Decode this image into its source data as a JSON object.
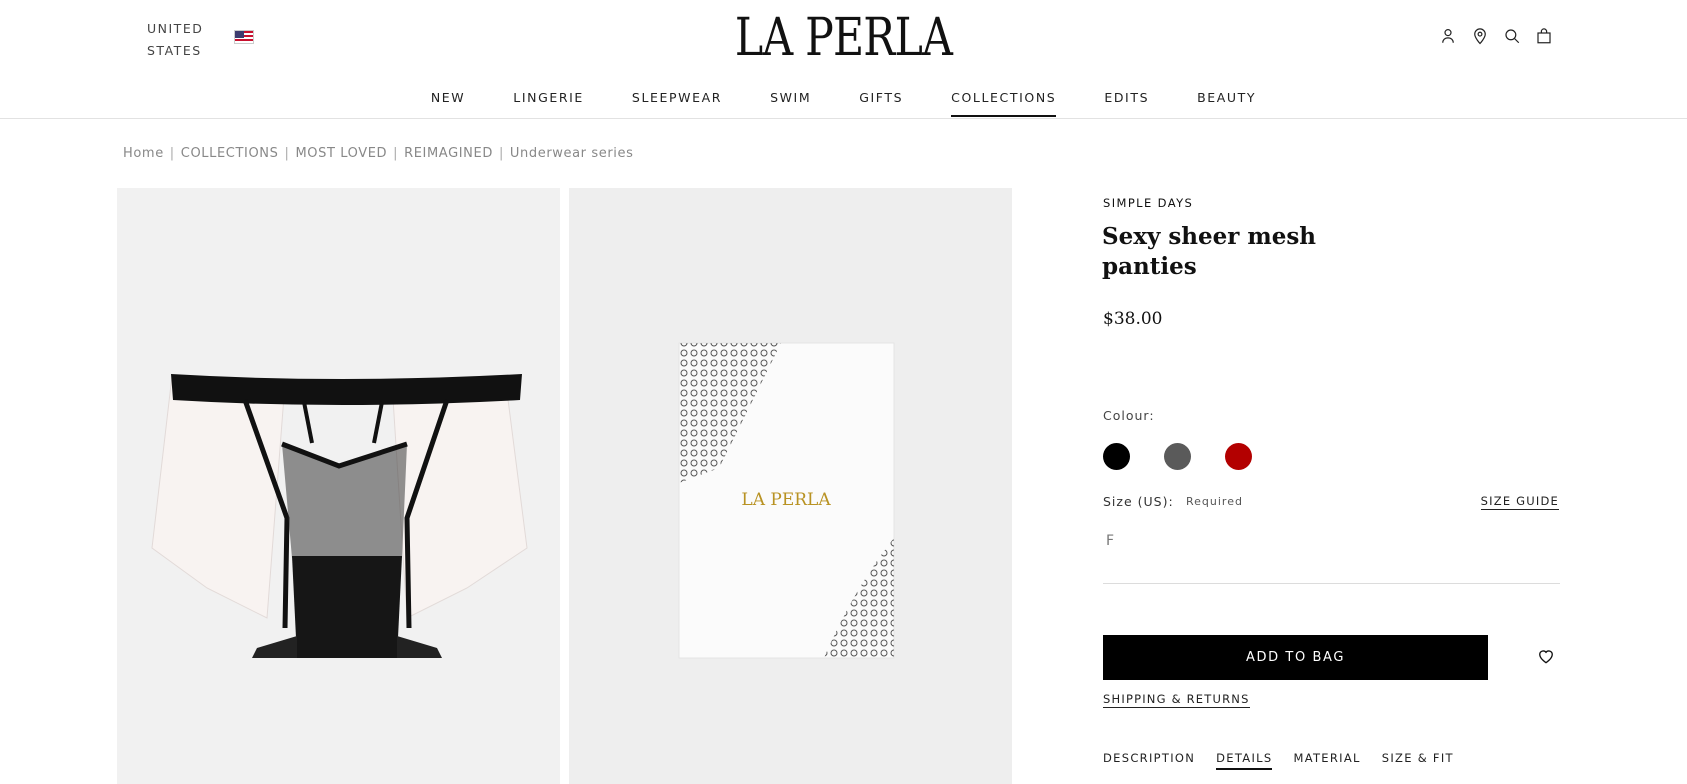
{
  "header": {
    "region_line1": "UNITED",
    "region_line2": "STATES",
    "logo": "LA PERLA",
    "icons": [
      "account-icon",
      "store-locator-icon",
      "search-icon",
      "bag-icon"
    ]
  },
  "nav": [
    "NEW",
    "LINGERIE",
    "SLEEPWEAR",
    "SWIM",
    "GIFTS",
    "COLLECTIONS",
    "EDITS",
    "BEAUTY"
  ],
  "nav_active": "COLLECTIONS",
  "breadcrumb": [
    "Home",
    "COLLECTIONS",
    "MOST LOVED",
    "REIMAGINED",
    "Underwear series"
  ],
  "gallery": {
    "box_logo": "LA PERLA"
  },
  "product": {
    "brand": "SIMPLE DAYS",
    "title": "Sexy sheer mesh panties",
    "price": "$38.00",
    "colour_label": "Colour:",
    "colours": [
      "#000000",
      "#5a5a5a",
      "#b30000"
    ],
    "size_label": "Size (US):",
    "size_required": "Required",
    "size_guide": "SIZE GUIDE",
    "size_option": "F",
    "add_to_bag": "ADD TO BAG",
    "shipping_returns": "SHIPPING & RETURNS",
    "tabs": [
      "DESCRIPTION",
      "DETAILS",
      "MATERIAL",
      "SIZE & FIT"
    ],
    "active_tab": "DETAILS"
  }
}
